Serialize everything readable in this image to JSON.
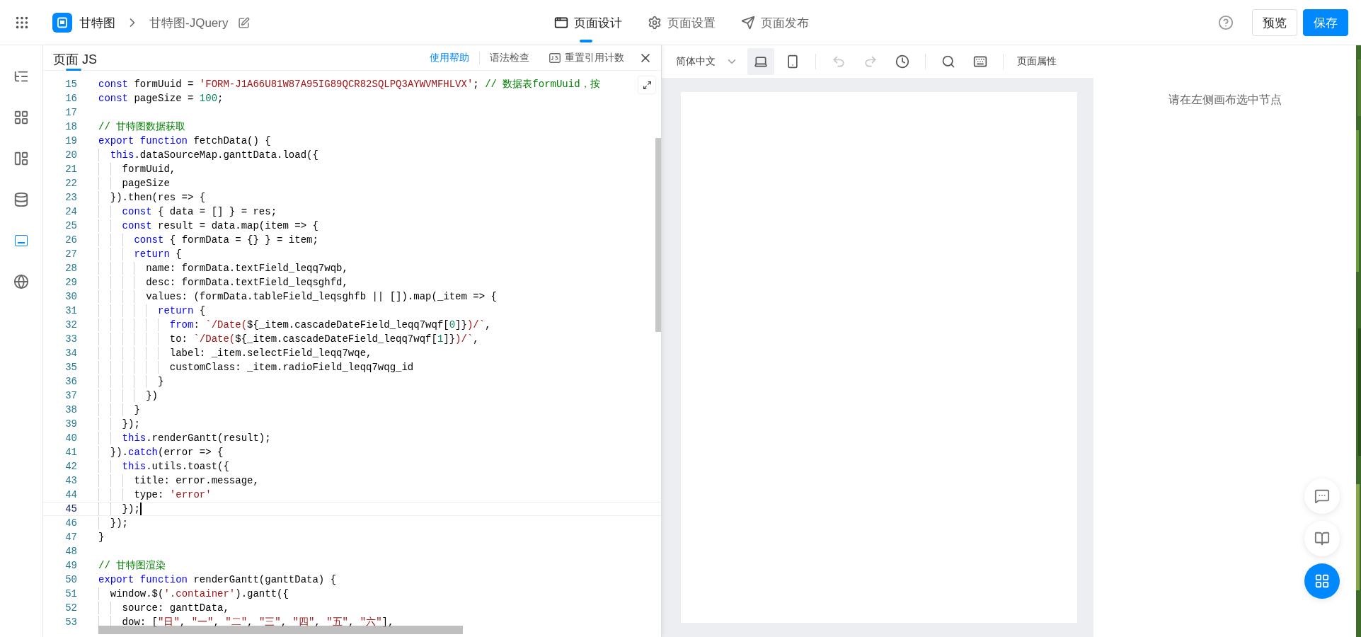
{
  "header": {
    "app_name": "甘特图",
    "page_name": "甘特图-JQuery",
    "tabs": [
      {
        "kind": "design",
        "label": "页面设计",
        "selected": true
      },
      {
        "kind": "settings",
        "label": "页面设置",
        "selected": false
      },
      {
        "kind": "publish",
        "label": "页面发布",
        "selected": false
      }
    ],
    "buttons": [
      {
        "kind": "secondary",
        "label": "预览"
      },
      {
        "kind": "primary",
        "label": "保存"
      }
    ]
  },
  "sidebar": {
    "items": [
      {
        "kind": "outline",
        "selected": false
      },
      {
        "kind": "components",
        "selected": false
      },
      {
        "kind": "layout",
        "selected": false
      },
      {
        "kind": "datasource",
        "selected": false
      },
      {
        "kind": "js",
        "selected": true
      },
      {
        "kind": "globe",
        "selected": false
      }
    ]
  },
  "code_panel": {
    "title": "页面 JS",
    "actions": [
      {
        "kind": "link",
        "label": "使用帮助"
      },
      {
        "kind": "plain",
        "label": "语法检查"
      },
      {
        "kind": "js",
        "label": "重置引用计数"
      }
    ],
    "lines": [
      {
        "number": "15",
        "current": false,
        "tokens": [
          {
            "kind": "keyword",
            "text": "const"
          },
          {
            "kind": "plain",
            "text": " formUuid = "
          },
          {
            "kind": "string",
            "text": "'FORM-J1A66U81W87A95IG89QCR82SQLPQ3AYWVMFHLVX'"
          },
          {
            "kind": "plain",
            "text": "; "
          },
          {
            "kind": "comment",
            "text": "// 数据表formUuid，按"
          }
        ]
      },
      {
        "number": "16",
        "current": false,
        "tokens": [
          {
            "kind": "keyword",
            "text": "const"
          },
          {
            "kind": "plain",
            "text": " pageSize = "
          },
          {
            "kind": "number",
            "text": "100"
          },
          {
            "kind": "plain",
            "text": ";"
          }
        ]
      },
      {
        "number": "17",
        "current": false
      },
      {
        "number": "18",
        "current": false,
        "tokens": [
          {
            "kind": "comment",
            "text": "// 甘特图数据获取"
          }
        ]
      },
      {
        "number": "19",
        "current": false,
        "tokens": [
          {
            "kind": "keyword",
            "text": "export function"
          },
          {
            "kind": "plain",
            "text": " fetchData() {"
          }
        ]
      },
      {
        "number": "20",
        "current": false,
        "tokens": [
          {
            "kind": "keyword",
            "text": "  this"
          },
          {
            "kind": "plain",
            "text": ".dataSourceMap.ganttData.load({"
          }
        ]
      },
      {
        "number": "21",
        "current": false,
        "tokens": [
          {
            "kind": "plain",
            "text": "    formUuid,"
          }
        ]
      },
      {
        "number": "22",
        "current": false,
        "tokens": [
          {
            "kind": "plain",
            "text": "    pageSize"
          }
        ]
      },
      {
        "number": "23",
        "current": false,
        "tokens": [
          {
            "kind": "plain",
            "text": "  }).then(res => {"
          }
        ]
      },
      {
        "number": "24",
        "current": false,
        "tokens": [
          {
            "kind": "keyword",
            "text": "    const"
          },
          {
            "kind": "plain",
            "text": " { data = [] } = res;"
          }
        ]
      },
      {
        "number": "25",
        "current": false,
        "tokens": [
          {
            "kind": "keyword",
            "text": "    const"
          },
          {
            "kind": "plain",
            "text": " result = data.map(item => {"
          }
        ]
      },
      {
        "number": "26",
        "current": false,
        "tokens": [
          {
            "kind": "keyword",
            "text": "      const"
          },
          {
            "kind": "plain",
            "text": " { formData = {} } = item;"
          }
        ]
      },
      {
        "number": "27",
        "current": false,
        "tokens": [
          {
            "kind": "keyword",
            "text": "      return"
          },
          {
            "kind": "plain",
            "text": " {"
          }
        ]
      },
      {
        "number": "28",
        "current": false,
        "tokens": [
          {
            "kind": "plain",
            "text": "        name: formData.textField_leqq7wqb,"
          }
        ]
      },
      {
        "number": "29",
        "current": false,
        "tokens": [
          {
            "kind": "plain",
            "text": "        desc: formData.textField_leqsghfd,"
          }
        ]
      },
      {
        "number": "30",
        "current": false,
        "tokens": [
          {
            "kind": "plain",
            "text": "        values: (formData.tableField_leqsghfb || []).map(_item => {"
          }
        ]
      },
      {
        "number": "31",
        "current": false,
        "tokens": [
          {
            "kind": "keyword",
            "text": "          return"
          },
          {
            "kind": "plain",
            "text": " {"
          }
        ]
      },
      {
        "number": "32",
        "current": false,
        "tokens": [
          {
            "kind": "keyword",
            "text": "            from"
          },
          {
            "kind": "plain",
            "text": ": "
          },
          {
            "kind": "string",
            "text": "`/Date("
          },
          {
            "kind": "plain",
            "text": "${_item.cascadeDateField_leqq7wqf["
          },
          {
            "kind": "number",
            "text": "0"
          },
          {
            "kind": "plain",
            "text": "]}"
          },
          {
            "kind": "string",
            "text": ")/`"
          },
          {
            "kind": "plain",
            "text": ","
          }
        ]
      },
      {
        "number": "33",
        "current": false,
        "tokens": [
          {
            "kind": "plain",
            "text": "            to: "
          },
          {
            "kind": "string",
            "text": "`/Date("
          },
          {
            "kind": "plain",
            "text": "${_item.cascadeDateField_leqq7wqf["
          },
          {
            "kind": "number",
            "text": "1"
          },
          {
            "kind": "plain",
            "text": "]}"
          },
          {
            "kind": "string",
            "text": ")/`"
          },
          {
            "kind": "plain",
            "text": ","
          }
        ]
      },
      {
        "number": "34",
        "current": false,
        "tokens": [
          {
            "kind": "plain",
            "text": "            label: _item.selectField_leqq7wqe,"
          }
        ]
      },
      {
        "number": "35",
        "current": false,
        "tokens": [
          {
            "kind": "plain",
            "text": "            customClass: _item.radioField_leqq7wqg_id"
          }
        ]
      },
      {
        "number": "36",
        "current": false,
        "tokens": [
          {
            "kind": "plain",
            "text": "          }"
          }
        ]
      },
      {
        "number": "37",
        "current": false,
        "tokens": [
          {
            "kind": "plain",
            "text": "        })"
          }
        ]
      },
      {
        "number": "38",
        "current": false,
        "tokens": [
          {
            "kind": "plain",
            "text": "      }"
          }
        ]
      },
      {
        "number": "39",
        "current": false,
        "tokens": [
          {
            "kind": "plain",
            "text": "    });"
          }
        ]
      },
      {
        "number": "40",
        "current": false,
        "tokens": [
          {
            "kind": "keyword",
            "text": "    this"
          },
          {
            "kind": "plain",
            "text": ".renderGantt(result);"
          }
        ]
      },
      {
        "number": "41",
        "current": false,
        "tokens": [
          {
            "kind": "plain",
            "text": "  })."
          },
          {
            "kind": "keyword",
            "text": "catch"
          },
          {
            "kind": "plain",
            "text": "(error => {"
          }
        ]
      },
      {
        "number": "42",
        "current": false,
        "tokens": [
          {
            "kind": "keyword",
            "text": "    this"
          },
          {
            "kind": "plain",
            "text": ".utils.toast({"
          }
        ]
      },
      {
        "number": "43",
        "current": false,
        "tokens": [
          {
            "kind": "plain",
            "text": "      title: error.message,"
          }
        ]
      },
      {
        "number": "44",
        "current": false,
        "tokens": [
          {
            "kind": "plain",
            "text": "      type: "
          },
          {
            "kind": "string",
            "text": "'error'"
          }
        ]
      },
      {
        "number": "45",
        "current": true,
        "tokens": [
          {
            "kind": "plain",
            "text": "    });"
          }
        ]
      },
      {
        "number": "46",
        "current": false,
        "tokens": [
          {
            "kind": "plain",
            "text": "  });"
          }
        ]
      },
      {
        "number": "47",
        "current": false,
        "tokens": [
          {
            "kind": "plain",
            "text": "}"
          }
        ]
      },
      {
        "number": "48",
        "current": false
      },
      {
        "number": "49",
        "current": false,
        "tokens": [
          {
            "kind": "comment",
            "text": "// 甘特图渲染"
          }
        ]
      },
      {
        "number": "50",
        "current": false,
        "tokens": [
          {
            "kind": "keyword",
            "text": "export function"
          },
          {
            "kind": "plain",
            "text": " renderGantt(ganttData) {"
          }
        ]
      },
      {
        "number": "51",
        "current": false,
        "tokens": [
          {
            "kind": "plain",
            "text": "  window.$("
          },
          {
            "kind": "string",
            "text": "'.container'"
          },
          {
            "kind": "plain",
            "text": ").gantt({"
          }
        ]
      },
      {
        "number": "52",
        "current": false,
        "tokens": [
          {
            "kind": "plain",
            "text": "    source: ganttData,"
          }
        ]
      },
      {
        "number": "53",
        "current": false,
        "tokens": [
          {
            "kind": "plain",
            "text": "    dow: ["
          },
          {
            "kind": "string",
            "text": "\"日\""
          },
          {
            "kind": "plain",
            "text": ", "
          },
          {
            "kind": "string",
            "text": "\"一\""
          },
          {
            "kind": "plain",
            "text": ", "
          },
          {
            "kind": "string",
            "text": "\"二\""
          },
          {
            "kind": "plain",
            "text": ", "
          },
          {
            "kind": "string",
            "text": "\"三\""
          },
          {
            "kind": "plain",
            "text": ", "
          },
          {
            "kind": "string",
            "text": "\"四\""
          },
          {
            "kind": "plain",
            "text": ", "
          },
          {
            "kind": "string",
            "text": "\"五\""
          },
          {
            "kind": "plain",
            "text": ", "
          },
          {
            "kind": "string",
            "text": "\"六\""
          },
          {
            "kind": "plain",
            "text": "],"
          }
        ]
      }
    ]
  },
  "canvas_toolbar": {
    "language": "简体中文",
    "devices": [
      {
        "kind": "desktop",
        "selected": true
      },
      {
        "kind": "mobile",
        "selected": false
      }
    ],
    "history": [
      {
        "kind": "undo",
        "disabled": true
      },
      {
        "kind": "redo",
        "disabled": true
      }
    ],
    "properties": "页面属性"
  },
  "inspector": {
    "empty_message": "请在左侧画布选中节点"
  }
}
